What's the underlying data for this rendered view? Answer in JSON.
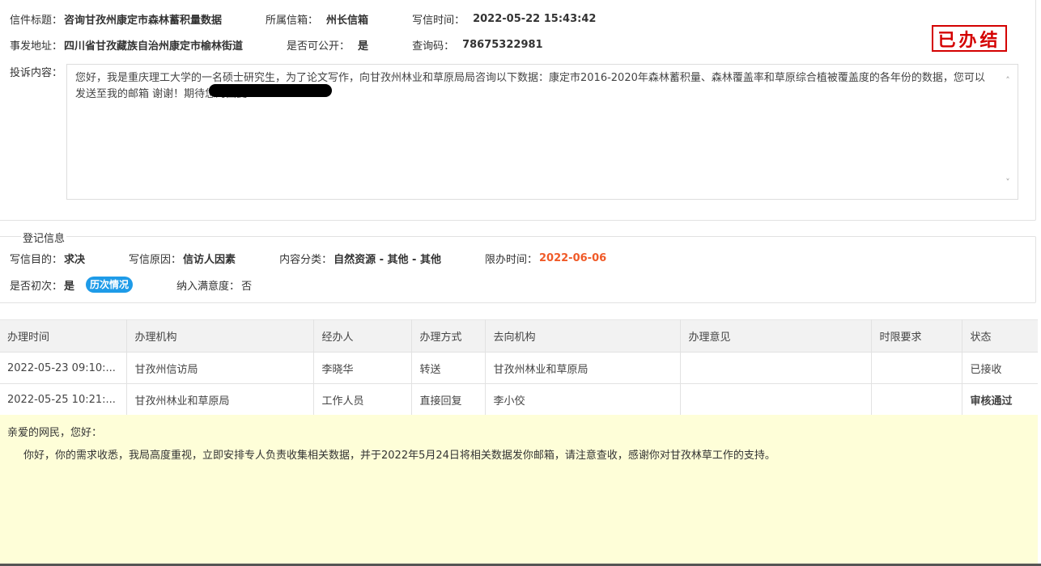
{
  "letter": {
    "title_label": "信件标题：",
    "title": "咨询甘孜州康定市森林蓄积量数据",
    "mailbox_label": "所属信箱：",
    "mailbox": "州长信箱",
    "time_label": "写信时间：",
    "time": "2022-05-22 15:43:42",
    "address_label": "事发地址：",
    "address": "四川省甘孜藏族自治州康定市榆林街道",
    "public_label": "是否可公开：",
    "public": "是",
    "code_label": "查询码：",
    "code": "78675322981",
    "stamp": "已办结",
    "complaint_label": "投诉内容：",
    "complaint_text": "您好，我是重庆理工大学的一名硕士研究生，为了论文写作，向甘孜州林业和草原局局咨询以下数据：康定市2016-2020年森林蓄积量、森林覆盖率和草原综合植被覆盖度的各年份的数据，您可以发送至我的邮箱                                        谢谢！期待您的回复"
  },
  "registration": {
    "legend": "登记信息",
    "purpose_label": "写信目的：",
    "purpose": "求决",
    "reason_label": "写信原因：",
    "reason": "信访人因素",
    "category_label": "内容分类：",
    "category": "自然资源 - 其他 - 其他",
    "deadline_label": "限办时间：",
    "deadline": "2022-06-06",
    "first_label": "是否初次：",
    "first": "是",
    "history_button": "历次情况",
    "satisfaction_label": "纳入满意度：",
    "satisfaction": "否",
    "deadline_color": "#f05a28"
  },
  "table": {
    "headers": [
      "办理时间",
      "办理机构",
      "经办人",
      "办理方式",
      "去向机构",
      "办理意见",
      "时限要求",
      "状态"
    ],
    "rows": [
      [
        "2022-05-23 09:10:...",
        "甘孜州信访局",
        "李晓华",
        "转送",
        "甘孜州林业和草原局",
        "",
        "",
        "已接收"
      ],
      [
        "2022-05-25 10:21:...",
        "甘孜州林业和草原局",
        "工作人员",
        "直接回复",
        "李小佼",
        "",
        "",
        "审核通过"
      ]
    ]
  },
  "reply": {
    "greeting": "亲爱的网民，您好：",
    "body": "你好，你的需求收悉，我局高度重视，立即安排专人负责收集相关数据，并于2022年5月24日将相关数据发你邮箱，请注意查收，感谢你对甘孜林草工作的支持。"
  }
}
